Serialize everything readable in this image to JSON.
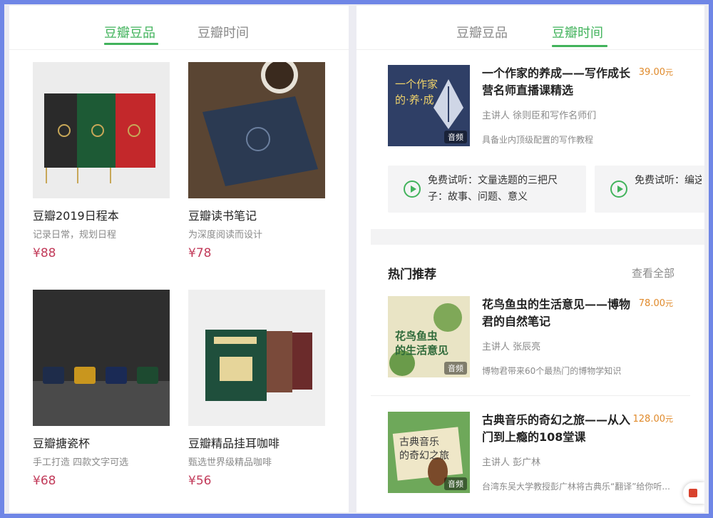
{
  "left": {
    "tabs": [
      {
        "label": "豆瓣豆品",
        "active": true
      },
      {
        "label": "豆瓣时间",
        "active": false
      }
    ],
    "products": [
      {
        "name": "豆瓣2019日程本",
        "desc": "记录日常，规划日程",
        "price": "¥88"
      },
      {
        "name": "豆瓣读书笔记",
        "desc": "为深度阅读而设计",
        "price": "¥78"
      },
      {
        "name": "豆瓣搪瓷杯",
        "desc": "手工打造 四款文字可选",
        "price": "¥68"
      },
      {
        "name": "豆瓣精品挂耳咖啡",
        "desc": "甄选世界级精品咖啡",
        "price": "¥56"
      }
    ]
  },
  "right": {
    "tabs": [
      {
        "label": "豆瓣豆品",
        "active": false
      },
      {
        "label": "豆瓣时间",
        "active": true
      }
    ],
    "featured": {
      "title": "一个作家的养成——写作成长营名师直播课精选",
      "price": "39.00",
      "unit": "元",
      "lecturer": "主讲人 徐则臣和写作名师们",
      "intro": "具备业内顶级配置的写作教程",
      "badge": "音频",
      "cover_text": [
        "一个作家",
        "的·养·成"
      ]
    },
    "trials": [
      {
        "text": "免费试听：文量选题的三把尺子：故事、问题、意义"
      },
      {
        "text": "免费试听：编这个样子"
      }
    ],
    "section": {
      "title": "热门推荐",
      "see_all": "查看全部"
    },
    "courses": [
      {
        "title": "花鸟鱼虫的生活意见——博物君的自然笔记",
        "price": "78.00",
        "unit": "元",
        "lecturer": "主讲人 张辰亮",
        "intro": "博物君带来60个最热门的博物学知识",
        "badge": "音频",
        "cover_text": [
          "花鸟鱼虫",
          "的生活意见"
        ]
      },
      {
        "title": "古典音乐的奇幻之旅——从入门到上瘾的108堂课",
        "price": "128.00",
        "unit": "元",
        "lecturer": "主讲人 彭广林",
        "intro": "台湾东吴大学教授彭广林将古典乐“翻译”给你听...",
        "badge": "音频",
        "cover_text": [
          "古典音乐",
          "的奇幻之旅"
        ]
      }
    ]
  },
  "colors": {
    "accent_green": "#42b35c",
    "price_red": "#c23b5a",
    "price_orange": "#e08a2b",
    "frame_blue": "#6f86e6"
  }
}
